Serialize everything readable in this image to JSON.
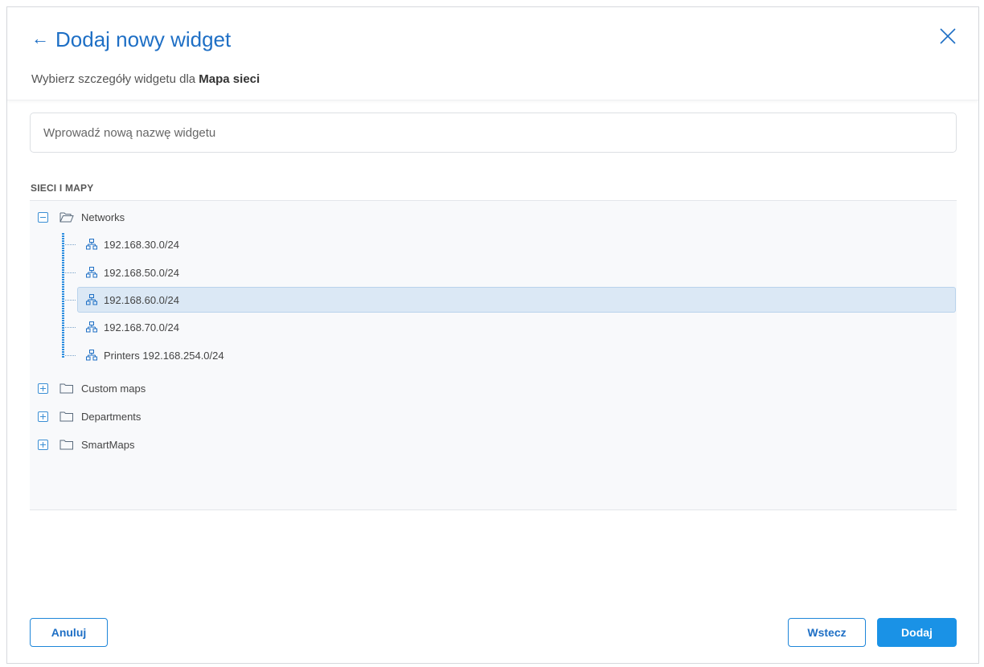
{
  "dialog": {
    "back_icon": "arrow-left-icon",
    "title": "Dodaj nowy widget",
    "close_icon": "close-icon",
    "subtitle_prefix": "Wybierz szczegóły widgetu dla",
    "subtitle_target": "Mapa sieci"
  },
  "name_field": {
    "placeholder": "Wprowadź nową nazwę widgetu",
    "value": ""
  },
  "tree": {
    "section_label": "SIECI I MAPY",
    "nodes": [
      {
        "label": "Networks",
        "expanded": true,
        "icon": "folder-open-icon",
        "children": [
          {
            "label": "192.168.30.0/24",
            "icon": "network-icon"
          },
          {
            "label": "192.168.50.0/24",
            "icon": "network-icon"
          },
          {
            "label": "192.168.60.0/24",
            "icon": "network-icon",
            "selected": true
          },
          {
            "label": "192.168.70.0/24",
            "icon": "network-icon"
          },
          {
            "label": "Printers 192.168.254.0/24",
            "icon": "network-icon"
          }
        ]
      },
      {
        "label": "Custom maps",
        "expanded": false,
        "icon": "folder-icon"
      },
      {
        "label": "Departments",
        "expanded": false,
        "icon": "folder-icon"
      },
      {
        "label": "SmartMaps",
        "expanded": false,
        "icon": "folder-icon"
      }
    ]
  },
  "footer": {
    "cancel_label": "Anuluj",
    "back_label": "Wstecz",
    "add_label": "Dodaj"
  },
  "colors": {
    "accent": "#1e6fc5",
    "primary_button": "#1a92e6",
    "selected_row": "#dbe8f5"
  }
}
